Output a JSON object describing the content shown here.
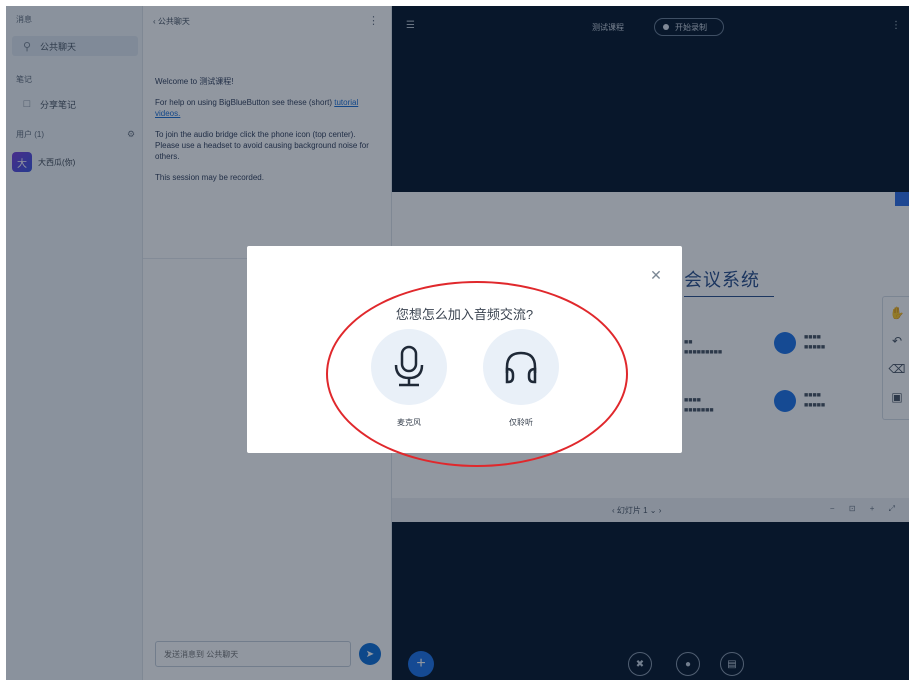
{
  "users_panel": {
    "messages_title": "消息",
    "public_chat_label": "公共聊天",
    "notes_title": "笔记",
    "shared_notes_label": "分享笔记",
    "users_title": "用户 (1)",
    "user_name": "大西瓜(你)",
    "avatar_initial": "大"
  },
  "chat": {
    "header": "‹ 公共聊天",
    "welcome_line1": "Welcome to 测试课程!",
    "welcome_line2": "For help on using BigBlueButton see these (short)",
    "tutorial_link": "tutorial videos.",
    "welcome_line3": "To join the audio bridge click the phone icon (top center). Please use a headset to avoid causing background noise for others.",
    "welcome_line4": "This session may be recorded.",
    "input_placeholder": "发送消息到 公共聊天"
  },
  "topbar": {
    "meeting_title": "测试课程",
    "record_label": "开始录制"
  },
  "slide": {
    "title_fragment": "会议系统",
    "rows": [
      {
        "title": "■■",
        "sub": "■■■■■■■■■"
      },
      {
        "title": "■■■■",
        "sub": "■■■■■"
      },
      {
        "title": "■■■■",
        "sub": "■■■■■■■"
      },
      {
        "title": "■■■■",
        "sub": "■■■■■"
      }
    ],
    "page_label": "幻灯片 1",
    "colors": {
      "accent": "#1e73e8",
      "title": "#2a4f8a"
    }
  },
  "modal": {
    "title": "您想怎么加入音频交流?",
    "microphone_label": "麦克风",
    "listen_only_label": "仅聆听"
  },
  "annotation": {
    "color": "#e0282c"
  }
}
